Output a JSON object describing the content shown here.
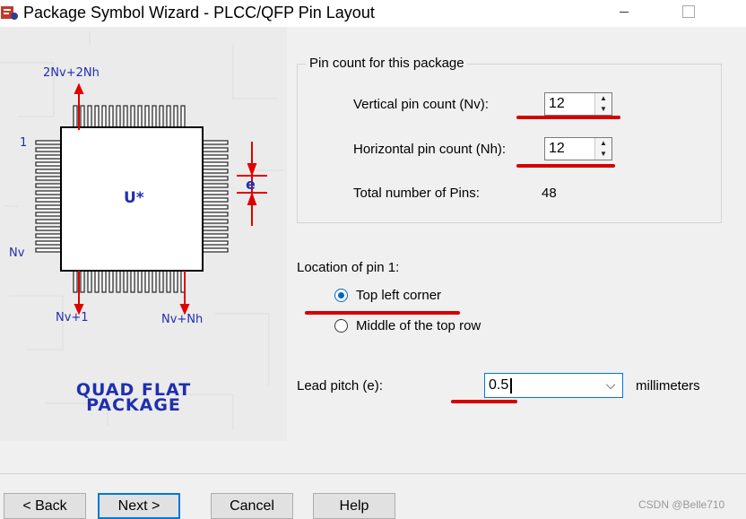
{
  "window": {
    "title": "Package Symbol Wizard - PLCC/QFP Pin Layout",
    "icon": "wizard-app-icon",
    "controls": [
      "minimize-icon",
      "maximize-icon"
    ]
  },
  "diagram": {
    "labels": {
      "top": "2Nv+2Nh",
      "pin1": "1",
      "nv": "Nv",
      "nv1": "Nv+1",
      "nvnh": "Nv+Nh",
      "center": "U*",
      "pitch": "e"
    },
    "package_title": [
      "QUAD FLAT",
      "PACKAGE"
    ],
    "colors": {
      "text": "#1f2fb0",
      "arrow": "#e00000",
      "body": "#000000"
    }
  },
  "pin_count": {
    "group_label": "Pin count for this package",
    "vertical_label": "Vertical pin count (Nv):",
    "vertical_value": "12",
    "horizontal_label": "Horizontal pin count (Nh):",
    "horizontal_value": "12",
    "total_label": "Total number of Pins:",
    "total_value": "48"
  },
  "pin1_location": {
    "label": "Location of pin 1:",
    "options": [
      {
        "label": "Top left corner",
        "selected": true
      },
      {
        "label": "Middle of the top row",
        "selected": false
      }
    ]
  },
  "lead_pitch": {
    "label": "Lead pitch (e):",
    "value": "0.5",
    "unit": "millimeters"
  },
  "buttons": {
    "back": "< Back",
    "next": "Next >",
    "cancel": "Cancel",
    "help": "Help"
  },
  "watermark": "CSDN @Belle710",
  "annotation_color": "#d40000"
}
